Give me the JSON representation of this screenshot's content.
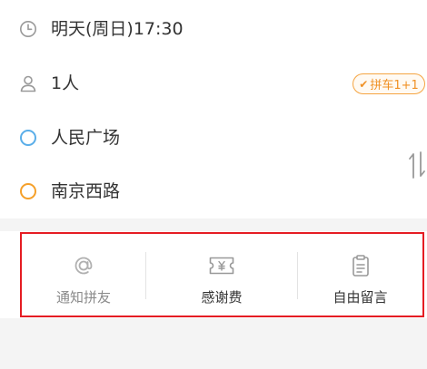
{
  "trip": {
    "time": "明天(周日)17:30",
    "passengers": "1人",
    "carpool_badge": "拼车1+1",
    "start": "人民广场",
    "end": "南京西路"
  },
  "colors": {
    "start_dot": "#5aaee9",
    "end_dot": "#f5a02a",
    "badge": "#f09124",
    "highlight": "#e51c23"
  },
  "actions": [
    {
      "label": "通知拼友",
      "icon": "at-icon",
      "enabled": false
    },
    {
      "label": "感谢费",
      "icon": "ticket-yen-icon",
      "enabled": true
    },
    {
      "label": "自由留言",
      "icon": "clipboard-icon",
      "enabled": true
    }
  ]
}
